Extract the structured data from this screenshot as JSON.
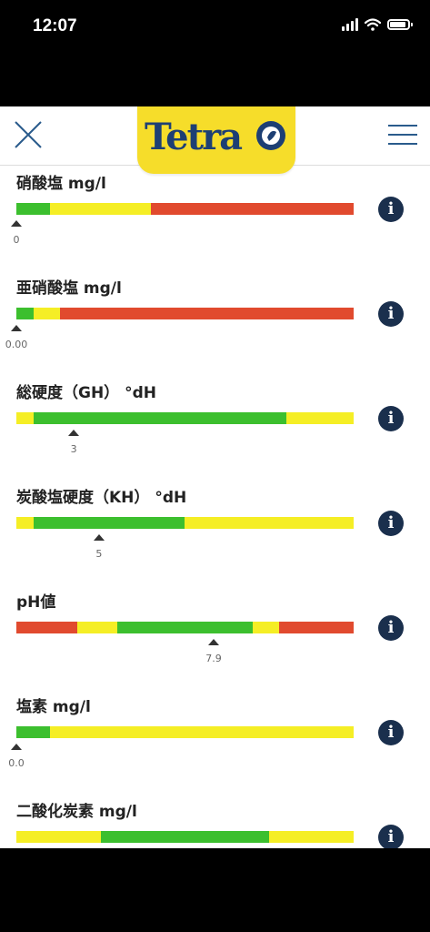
{
  "status": {
    "time": "12:07"
  },
  "header": {
    "logo_text": "Tetra"
  },
  "colors": {
    "green": "#3cbf2e",
    "yellow": "#f5ee25",
    "red": "#e14a2e",
    "navy": "#1a2f4d"
  },
  "params": [
    {
      "label": "硝酸塩 mg/l",
      "value": "0",
      "segments": [
        [
          "green",
          0.1
        ],
        [
          "yellow",
          0.3
        ],
        [
          "red",
          0.6
        ]
      ],
      "marker": 0.0
    },
    {
      "label": "亜硝酸塩 mg/l",
      "value": "0.00",
      "segments": [
        [
          "green",
          0.05
        ],
        [
          "yellow",
          0.08
        ],
        [
          "red",
          0.87
        ]
      ],
      "marker": 0.0
    },
    {
      "label": "総硬度（GH） °dH",
      "value": "3",
      "segments": [
        [
          "yellow",
          0.05
        ],
        [
          "green",
          0.75
        ],
        [
          "yellow",
          0.2
        ]
      ],
      "marker": 0.17
    },
    {
      "label": "炭酸塩硬度（KH） °dH",
      "value": "5",
      "segments": [
        [
          "yellow",
          0.05
        ],
        [
          "green",
          0.45
        ],
        [
          "yellow",
          0.5
        ]
      ],
      "marker": 0.245
    },
    {
      "label": "pH値",
      "value": "7.9",
      "segments": [
        [
          "red",
          0.18
        ],
        [
          "yellow",
          0.12
        ],
        [
          "green",
          0.4
        ],
        [
          "yellow",
          0.08
        ],
        [
          "red",
          0.22
        ]
      ],
      "marker": 0.585
    },
    {
      "label": "塩素 mg/l",
      "value": "0.0",
      "segments": [
        [
          "green",
          0.1
        ],
        [
          "yellow",
          0.9
        ]
      ],
      "marker": 0.0
    },
    {
      "label": "二酸化炭素 mg/l",
      "value": "",
      "segments": [
        [
          "yellow",
          0.25
        ],
        [
          "green",
          0.5
        ],
        [
          "yellow",
          0.25
        ]
      ],
      "marker": null
    }
  ]
}
